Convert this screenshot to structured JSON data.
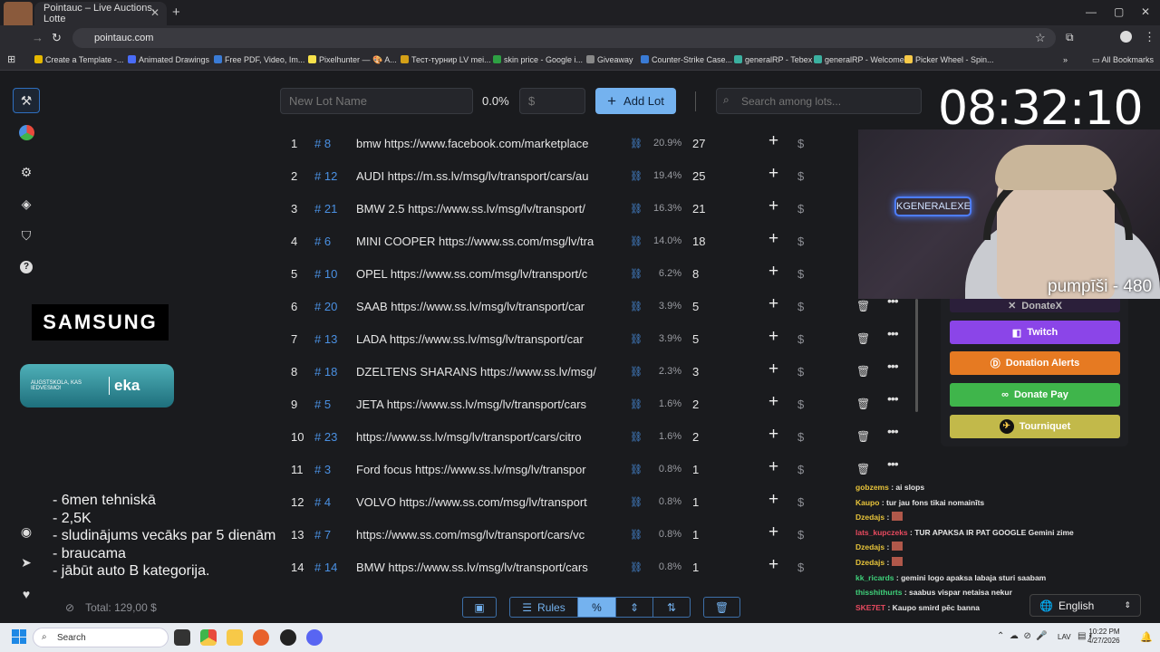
{
  "browser": {
    "tab_title": "Pointauc – Live Auctions, Lotte",
    "url": "pointauc.com",
    "bookmarks": [
      {
        "label": "Create a Template -...",
        "color": "#e5b800"
      },
      {
        "label": "Animated Drawings",
        "color": "#4a6cf7"
      },
      {
        "label": "Free PDF, Video, Im...",
        "color": "#3a7bd5"
      },
      {
        "label": "Pixelhunter — 🎨 A...",
        "color": "#f7e14a"
      },
      {
        "label": "Тест-турнир LV mei...",
        "color": "#d4a017"
      },
      {
        "label": "skin price - Google i...",
        "color": "#2ea043"
      },
      {
        "label": "Giveaway",
        "color": "#888888"
      },
      {
        "label": "Counter-Strike Case...",
        "color": "#3a7bd5"
      },
      {
        "label": "generalRP - Tebex",
        "color": "#3bb0a0"
      },
      {
        "label": "generalRP - Welcome",
        "color": "#3bb0a0"
      },
      {
        "label": "Picker Wheel - Spin...",
        "color": "#f7c948"
      }
    ],
    "all_bookmarks": "All Bookmarks"
  },
  "toolbar": {
    "lot_name_placeholder": "New Lot Name",
    "percent": "0.0%",
    "amount_placeholder": "$",
    "add_lot_label": "Add Lot",
    "search_placeholder": "Search among lots..."
  },
  "timer": "08:32:10",
  "lots": [
    {
      "idx": "1",
      "id": "# 8",
      "name": "bmw  https://www.facebook.com/marketplace",
      "pct": "20.9%",
      "amount": "27"
    },
    {
      "idx": "2",
      "id": "# 12",
      "name": "AUDI https://m.ss.lv/msg/lv/transport/cars/au",
      "pct": "19.4%",
      "amount": "25"
    },
    {
      "idx": "3",
      "id": "# 21",
      "name": "BMW 2.5 https://www.ss.lv/msg/lv/transport/",
      "pct": "16.3%",
      "amount": "21"
    },
    {
      "idx": "4",
      "id": "# 6",
      "name": "MINI COOPER https://www.ss.com/msg/lv/tra",
      "pct": "14.0%",
      "amount": "18"
    },
    {
      "idx": "5",
      "id": "# 10",
      "name": "OPEL https://www.ss.com/msg/lv/transport/c",
      "pct": "6.2%",
      "amount": "8"
    },
    {
      "idx": "6",
      "id": "# 20",
      "name": "SAAB https://www.ss.lv/msg/lv/transport/car",
      "pct": "3.9%",
      "amount": "5"
    },
    {
      "idx": "7",
      "id": "# 13",
      "name": "LADA https://www.ss.lv/msg/lv/transport/car",
      "pct": "3.9%",
      "amount": "5"
    },
    {
      "idx": "8",
      "id": "# 18",
      "name": "DZELTENS SHARANS https://www.ss.lv/msg/",
      "pct": "2.3%",
      "amount": "3"
    },
    {
      "idx": "9",
      "id": "# 5",
      "name": "JETA https://www.ss.lv/msg/lv/transport/cars",
      "pct": "1.6%",
      "amount": "2"
    },
    {
      "idx": "10",
      "id": "# 23",
      "name": "https://www.ss.lv/msg/lv/transport/cars/citro",
      "pct": "1.6%",
      "amount": "2"
    },
    {
      "idx": "11",
      "id": "# 3",
      "name": "Ford focus https://www.ss.lv/msg/lv/transpor",
      "pct": "0.8%",
      "amount": "1"
    },
    {
      "idx": "12",
      "id": "# 4",
      "name": "VOLVO https://www.ss.com/msg/lv/transport",
      "pct": "0.8%",
      "amount": "1"
    },
    {
      "idx": "13",
      "id": "# 7",
      "name": "https://www.ss.com/msg/lv/transport/cars/vc",
      "pct": "0.8%",
      "amount": "1"
    },
    {
      "idx": "14",
      "id": "# 14",
      "name": "BMW https://www.ss.lv/msg/lv/transport/cars",
      "pct": "0.8%",
      "amount": "1"
    }
  ],
  "sponsors": {
    "samsung": "SAMSUNG",
    "eka_tagline": "AUGSTSKOLA, KAS IEDVESMO!",
    "eka": "eka"
  },
  "notes": [
    "- 6men tehniskā",
    "- 2,5K",
    "- sludinājums vecāks par 5 dienām",
    "- braucama",
    "- jābūt auto B kategorija."
  ],
  "total": "Total: 129,00 $",
  "stream_caption": "pumpīši - 480",
  "neon_sign": "KGENERALEXE",
  "donations": [
    {
      "label": "DonateX",
      "color": "#2b1f3a"
    },
    {
      "label": "Twitch",
      "color": "#8b45e8"
    },
    {
      "label": "Donation Alerts",
      "color": "#e67a22"
    },
    {
      "label": "Donate Pay",
      "color": "#3fb54b"
    },
    {
      "label": "Tourniquet",
      "color": "#c2b94a"
    }
  ],
  "chat": [
    {
      "user": "gobzems",
      "color": "#e8c43a",
      "msg": " : ai slops"
    },
    {
      "user": "Kaupo",
      "color": "#e8c43a",
      "msg": " : tur jau fons tikai nomainīts"
    },
    {
      "user": "Dzedajs",
      "color": "#e8c43a",
      "msg": " : "
    },
    {
      "user": "lats_kupczeks",
      "color": "#e84a5f",
      "msg": " : TUR APAKSA IR PAT GOOGLE Gemini zime"
    },
    {
      "user": "Dzedajs",
      "color": "#e8c43a",
      "msg": " : "
    },
    {
      "user": "Dzedajs",
      "color": "#e8c43a",
      "msg": " : "
    },
    {
      "user": "kk_ricards",
      "color": "#3fd17a",
      "msg": " : gemini logo apaksa labaja sturi saabam"
    },
    {
      "user": "thisshithurts",
      "color": "#3fd17a",
      "msg": " : saabus vispar netaisa nekur"
    },
    {
      "user": "SKE7ET",
      "color": "#e84a5f",
      "msg": " : Kaupo smird pēc banna"
    }
  ],
  "language": "English",
  "bottom_tools": {
    "rules": "Rules"
  },
  "taskbar": {
    "search": "Search",
    "lang": "LAV",
    "time": "10:22 PM",
    "date": "4/27/2026"
  }
}
